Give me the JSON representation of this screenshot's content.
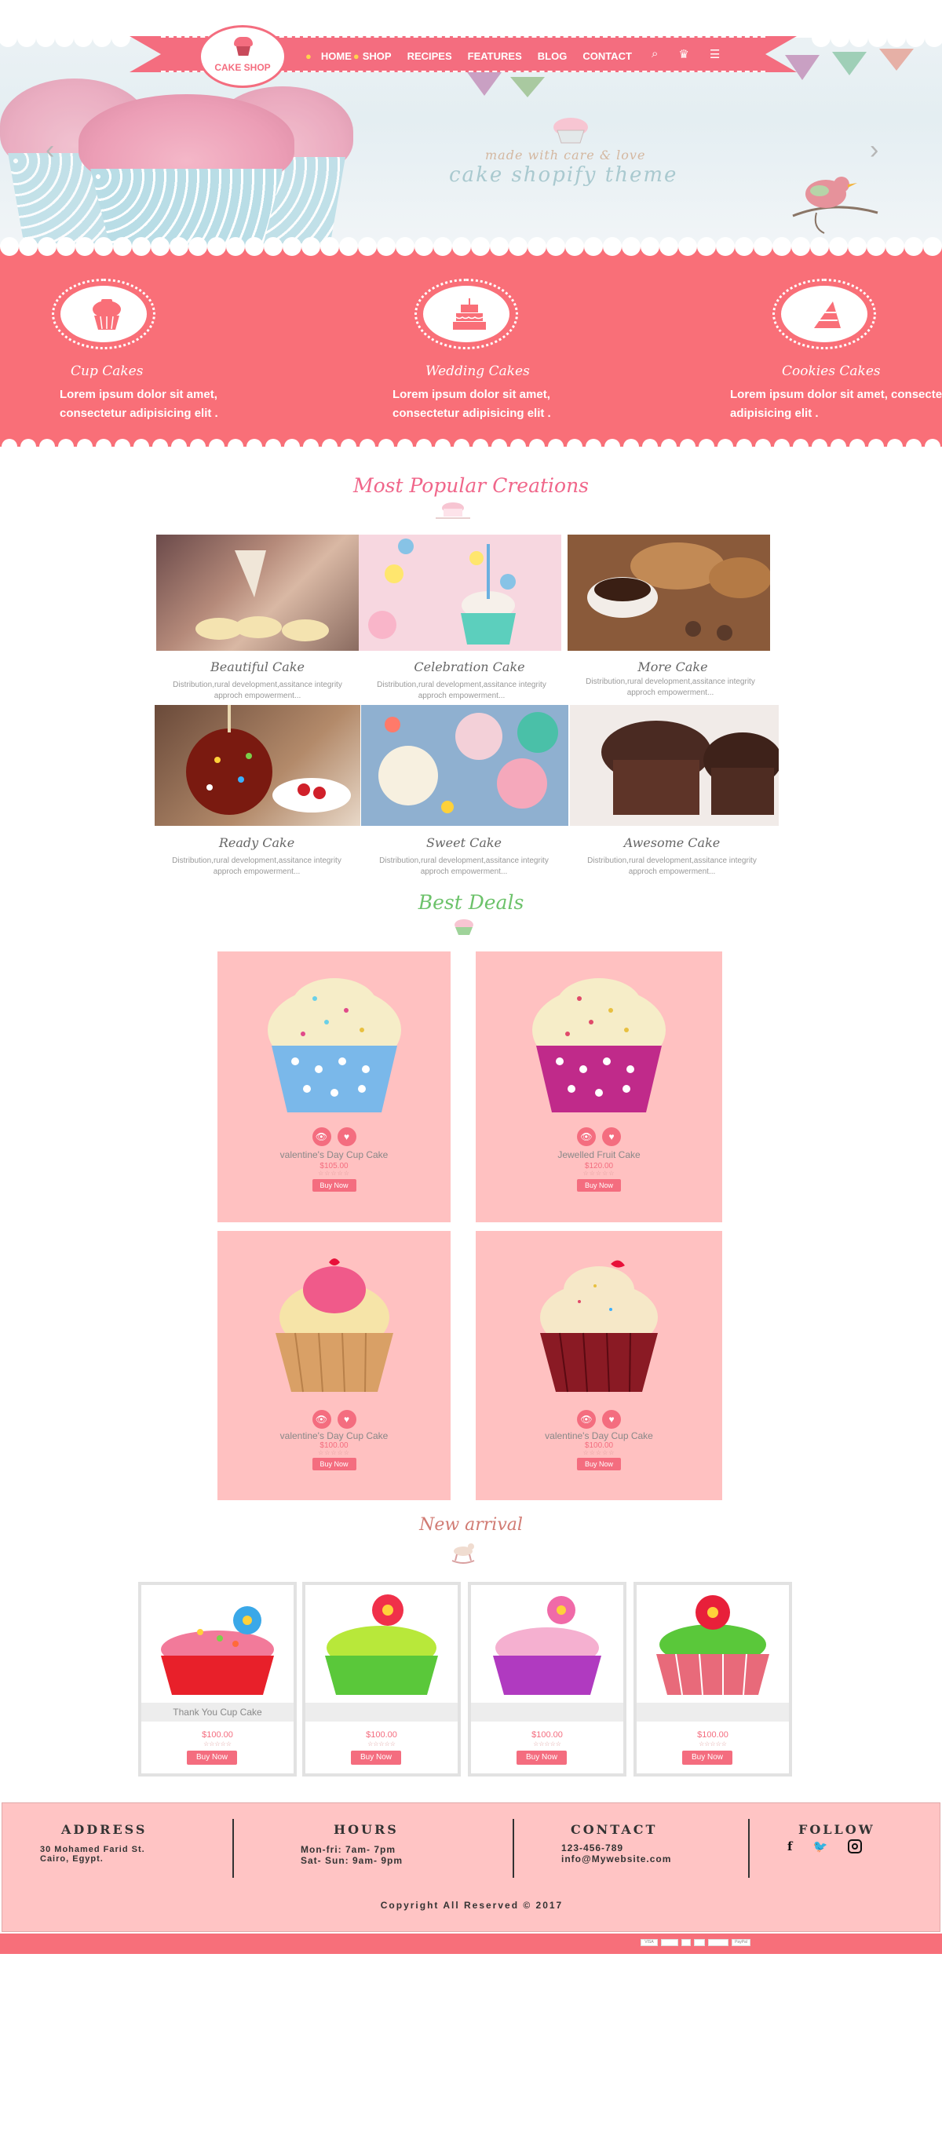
{
  "nav": {
    "logo_text": "CAKE SHOP",
    "items": [
      "HOME",
      "SHOP",
      "RECIPES",
      "FEATURES",
      "BLOG",
      "CONTACT"
    ],
    "icons": [
      "search-icon",
      "crown-icon",
      "menu-icon"
    ]
  },
  "hero": {
    "tagline": "made with care & love",
    "theme_title": "cake shopify theme",
    "prev": "‹",
    "next": "›"
  },
  "features": [
    {
      "title": "Cup Cakes",
      "desc": "Lorem ipsum dolor sit amet, consectetur adipisicing elit .",
      "icon": "cupcake-icon"
    },
    {
      "title": "Wedding Cakes",
      "desc": "Lorem ipsum dolor sit amet, consectetur adipisicing elit .",
      "icon": "wedding-cake-icon"
    },
    {
      "title": "Cookies Cakes",
      "desc": "Lorem ipsum dolor sit amet, consectetur adipisicing elit .",
      "icon": "cake-slice-icon"
    }
  ],
  "popular": {
    "title": "Most Popular Creations",
    "items": [
      {
        "title": "Beautiful Cake",
        "desc": "Distribution,rural development,assitance integrity approch empowerment..."
      },
      {
        "title": "Celebration Cake",
        "desc": "Distribution,rural development,assitance integrity approch empowerment..."
      },
      {
        "title": "More Cake",
        "desc": "Distribution,rural development,assitance integrity approch empowerment..."
      },
      {
        "title": "Ready Cake",
        "desc": "Distribution,rural development,assitance integrity approch empowerment..."
      },
      {
        "title": "Sweet Cake",
        "desc": "Distribution,rural development,assitance integrity approch empowerment..."
      },
      {
        "title": "Awesome Cake",
        "desc": "Distribution,rural development,assitance integrity approch empowerment..."
      }
    ]
  },
  "deals": {
    "title": "Best Deals",
    "items": [
      {
        "name": "valentine's Day Cup Cake",
        "price": "$105.00",
        "stars": "☆☆☆☆☆",
        "buy": "Buy Now"
      },
      {
        "name": "Jewelled Fruit Cake",
        "price": "$120.00",
        "stars": "☆☆☆☆☆",
        "buy": "Buy Now"
      },
      {
        "name": "valentine's Day Cup Cake",
        "price": "$100.00",
        "stars": "☆☆☆☆☆",
        "buy": "Buy Now"
      },
      {
        "name": "valentine's Day Cup Cake",
        "price": "$100.00",
        "stars": "☆☆☆☆☆",
        "buy": "Buy Now"
      }
    ]
  },
  "arrivals": {
    "title": "New arrival",
    "items": [
      {
        "name": "Thank You Cup Cake",
        "price": "$100.00",
        "stars": "☆☆☆☆☆",
        "buy": "Buy Now"
      },
      {
        "name": "",
        "price": "$100.00",
        "stars": "☆☆☆☆☆",
        "buy": "Buy Now"
      },
      {
        "name": "",
        "price": "$100.00",
        "stars": "☆☆☆☆☆",
        "buy": "Buy Now"
      },
      {
        "name": "",
        "price": "$100.00",
        "stars": "☆☆☆☆☆",
        "buy": "Buy Now"
      }
    ]
  },
  "footer": {
    "address_title": "ADDRESS",
    "address_line1": "30 Mohamed Farid St.",
    "address_line2": "Cairo, Egypt.",
    "hours_title": "HOURS",
    "hours_line1": "Mon-fri: 7am- 7pm",
    "hours_line2": "Sat- Sun: 9am- 9pm",
    "contact_title": "CONTACT",
    "phone": "123-456-789",
    "email": "info@Mywebsite.com",
    "follow_title": "FOLLOW",
    "social": [
      "facebook-icon",
      "twitter-icon",
      "instagram-icon"
    ],
    "copyright": "Copyright All Reserved © 2017",
    "payments": [
      "VISA",
      "",
      "",
      "",
      "",
      "PayPal"
    ]
  },
  "colors": {
    "brand_pink": "#f46d7f",
    "feature_band": "#f96f78",
    "deal_bg": "#ffc1c1",
    "footer_bg": "#ffc4c4",
    "best_deals_green": "#6cc26a",
    "popular_pink": "#f0668a",
    "new_arrival": "#d17b73"
  }
}
